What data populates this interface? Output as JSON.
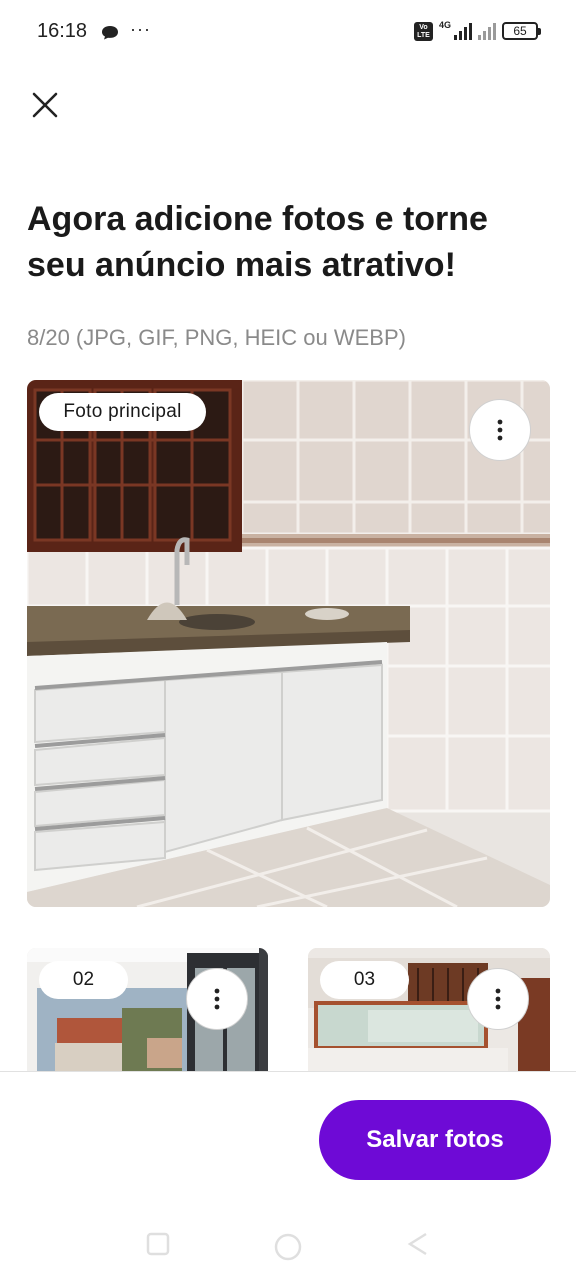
{
  "status_bar": {
    "time": "16:18",
    "more": "···",
    "volte": "Vo LTE",
    "network": "4G",
    "battery": "65"
  },
  "header": {
    "close_icon": "close-icon"
  },
  "content": {
    "title": "Agora adicione fotos e torne seu anúncio mais atrativo!",
    "counter": "8/20 (JPG, GIF, PNG, HEIC ou WEBP)"
  },
  "photos": [
    {
      "badge": "Foto principal",
      "menu_icon": "more-vertical-icon"
    },
    {
      "badge": "02",
      "menu_icon": "more-vertical-icon"
    },
    {
      "badge": "03",
      "menu_icon": "more-vertical-icon"
    }
  ],
  "footer": {
    "save_label": "Salvar fotos"
  },
  "colors": {
    "primary": "#6e0ad6",
    "text": "#1a1a1a",
    "muted": "#8a8a8a"
  }
}
